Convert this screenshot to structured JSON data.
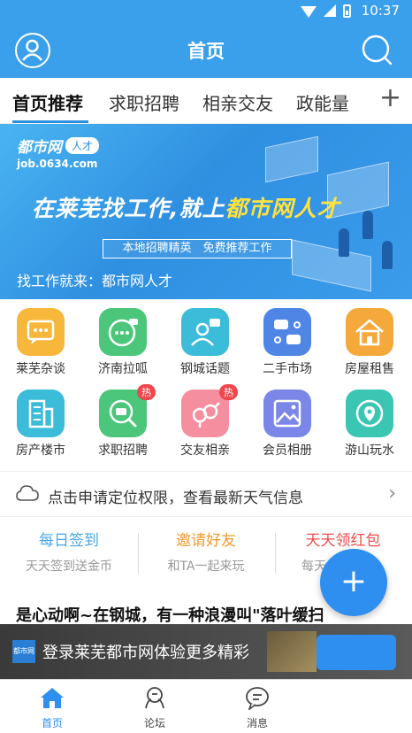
{
  "status_bar": {
    "time": "10:37"
  },
  "header": {
    "title": "首页"
  },
  "tabs": [
    {
      "label": "首页推荐",
      "active": true
    },
    {
      "label": "求职招聘",
      "active": false
    },
    {
      "label": "相亲交友",
      "active": false
    },
    {
      "label": "政能量",
      "active": false
    }
  ],
  "tab_add_label": "+",
  "banner": {
    "logo_text": "都市网",
    "logo_tag": "人才",
    "domain": "job.0634.com",
    "headline_part1": "在莱芜找工作,就上",
    "headline_highlight": "都市网人才",
    "subtag": "本地招聘精英　免费推荐工作",
    "footline": "找工作就来：都市网人才"
  },
  "grid_items": [
    {
      "label": "莱芜杂谈",
      "icon": "chat-bubble-icon",
      "color": "#f7b73b",
      "badge": ""
    },
    {
      "label": "济南拉呱",
      "icon": "chat-dots-icon",
      "color": "#4cc67a",
      "badge": ""
    },
    {
      "label": "钢城话题",
      "icon": "person-talk-icon",
      "color": "#3bbcd8",
      "badge": ""
    },
    {
      "label": "二手市场",
      "icon": "trade-icon",
      "color": "#4f86e6",
      "badge": ""
    },
    {
      "label": "房屋租售",
      "icon": "house-icon",
      "color": "#f6a93b",
      "badge": ""
    },
    {
      "label": "房产楼市",
      "icon": "building-icon",
      "color": "#3bbcd8",
      "badge": ""
    },
    {
      "label": "求职招聘",
      "icon": "recruit-icon",
      "color": "#4cc67a",
      "badge": "热"
    },
    {
      "label": "交友相亲",
      "icon": "gender-icon",
      "color": "#f58fa0",
      "badge": "热"
    },
    {
      "label": "会员相册",
      "icon": "photo-icon",
      "color": "#7a86e8",
      "badge": ""
    },
    {
      "label": "游山玩水",
      "icon": "location-icon",
      "color": "#3bc6b4",
      "badge": ""
    }
  ],
  "weather": {
    "text": "点击申请定位权限，查看最新天气信息",
    "chevron": "›"
  },
  "cards": [
    {
      "title": "每日签到",
      "sub": "天天签到送金币",
      "color": "#4aa6ea"
    },
    {
      "title": "邀请好友",
      "sub": "和TA一起来玩",
      "color": "#f39a2e"
    },
    {
      "title": "天天领红包",
      "sub": "每天",
      "color": "#ef4b4b"
    }
  ],
  "fab_label": "+",
  "article": {
    "title": "是心动啊~在钢城，有一种浪漫叫\"落叶缓扫"
  },
  "login_bar": {
    "thumb_text": "都市网",
    "text": "登录莱芜都市网体验更多精彩"
  },
  "bottom_nav": [
    {
      "label": "首页",
      "icon": "home-icon",
      "active": true
    },
    {
      "label": "论坛",
      "icon": "forum-icon",
      "active": false
    },
    {
      "label": "消息",
      "icon": "message-icon",
      "active": false
    }
  ],
  "colors": {
    "primary": "#3aa0ec",
    "accent": "#2e8ff0",
    "highlight": "#ffe23c",
    "badge": "#f0464c"
  }
}
